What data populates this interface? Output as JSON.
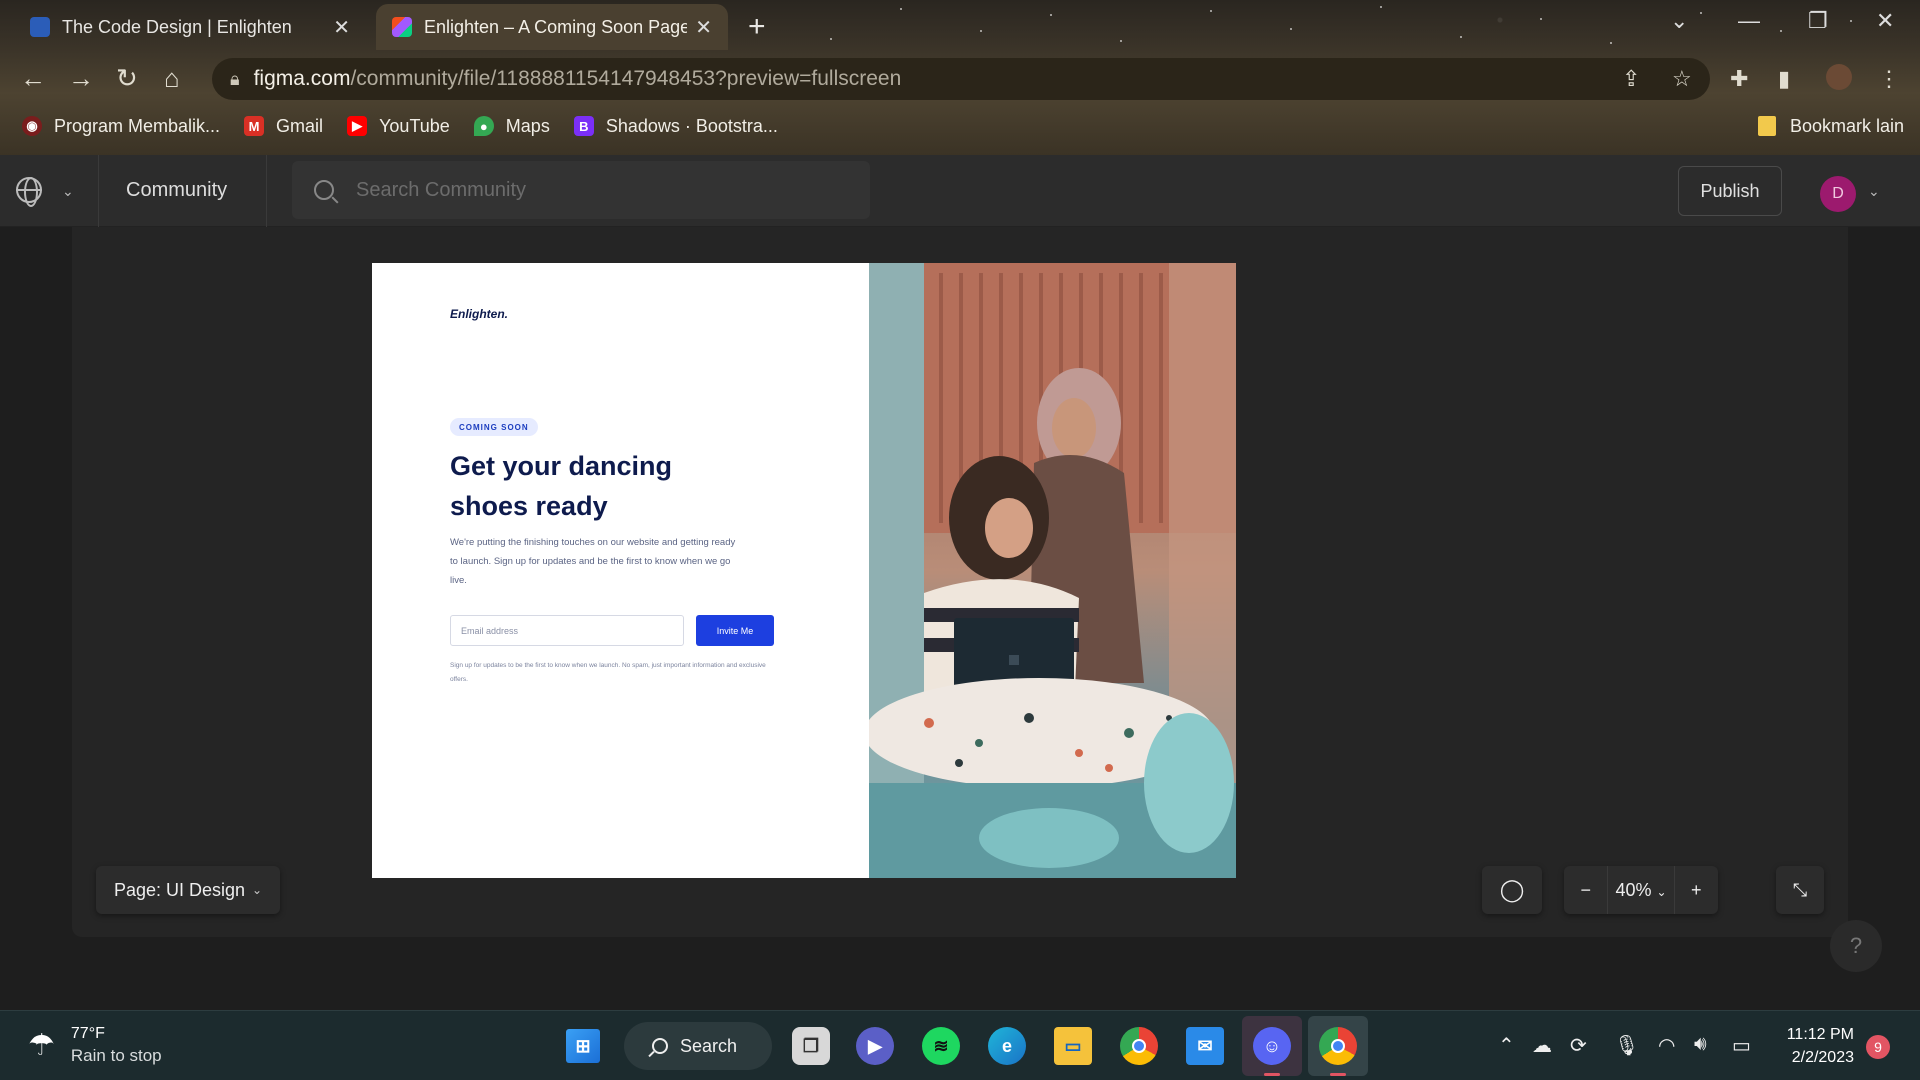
{
  "browser": {
    "tabs": [
      {
        "title": "The Code Design | Enlighten",
        "active": false
      },
      {
        "title": "Enlighten – A Coming Soon Page",
        "active": true
      }
    ],
    "url_host": "figma.com",
    "url_path": "/community/file/1188881154147948453?preview=fullscreen",
    "bookmarks": [
      {
        "label": "Program Membalik...",
        "icon": "program-icon",
        "color": "#7a1d1d"
      },
      {
        "label": "Gmail",
        "icon": "gmail-icon",
        "color": "#d93025"
      },
      {
        "label": "YouTube",
        "icon": "youtube-icon",
        "color": "#ff0000"
      },
      {
        "label": "Maps",
        "icon": "maps-icon",
        "color": "#34a853"
      },
      {
        "label": "Shadows · Bootstra...",
        "icon": "bootstrap-icon",
        "color": "#7b2ff7"
      }
    ],
    "other_bookmarks": "Bookmark lain"
  },
  "figma": {
    "section": "Community",
    "search_placeholder": "Search Community",
    "publish_label": "Publish",
    "avatar_initial": "D",
    "page_selector": "Page: UI Design",
    "zoom": "40%"
  },
  "design": {
    "brand": "Enlighten.",
    "badge": "COMING SOON",
    "headline": "Get your dancing shoes ready",
    "subtext": "We're putting the finishing touches on our website and getting ready to launch. Sign up for updates and be the first to know when we go live.",
    "email_placeholder": "Email address",
    "button": "Invite Me",
    "fine_print": "Sign up for updates to be the first to know when we launch. No spam, just important information and exclusive offers."
  },
  "taskbar": {
    "temperature": "77°F",
    "condition": "Rain to stop",
    "search_label": "Search",
    "time": "11:12 PM",
    "date": "2/2/2023",
    "notifications": "9"
  },
  "colors": {
    "accent_blue": "#1d3fe0",
    "heading_navy": "#0e1b4d",
    "figma_dark": "#2c2c2c"
  }
}
